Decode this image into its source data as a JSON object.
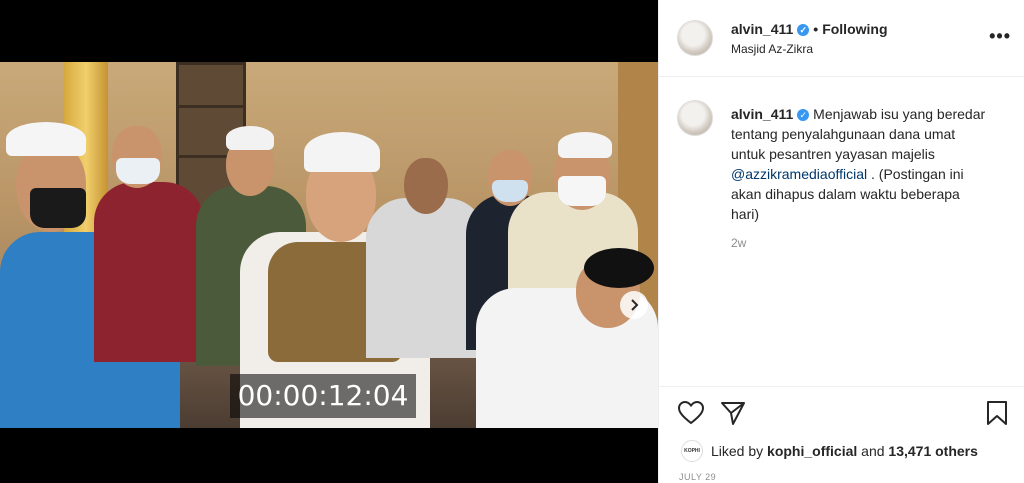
{
  "post": {
    "video_timecode": "00:00:12:04"
  },
  "header": {
    "username": "alvin_411",
    "separator": "•",
    "follow_state": "Following",
    "location": "Masjid Az-Zikra",
    "more_label": "•••"
  },
  "caption": {
    "username": "alvin_411",
    "text_before": "Menjawab isu yang beredar tentang penyalahgunaan dana umat untuk pesantren yayasan majelis ",
    "mention": "@azzikramediaofficial",
    "text_after": " . (Postingan ini akan dihapus dalam waktu beberapa hari)",
    "age": "2w"
  },
  "likes": {
    "prefix": "Liked by ",
    "user": "kophi_official",
    "middle": " and ",
    "count": "13,471 others",
    "avatar_text": "KOPHI"
  },
  "date": "JULY 29",
  "colors": {
    "verified": "#3897f0",
    "link": "#00376b",
    "muted": "#8e8e8e"
  },
  "icons": [
    "heart-icon",
    "comment-icon",
    "share-icon",
    "bookmark-icon",
    "chevron-right-icon",
    "user-tag-icon",
    "mute-icon",
    "verified-badge-icon"
  ]
}
